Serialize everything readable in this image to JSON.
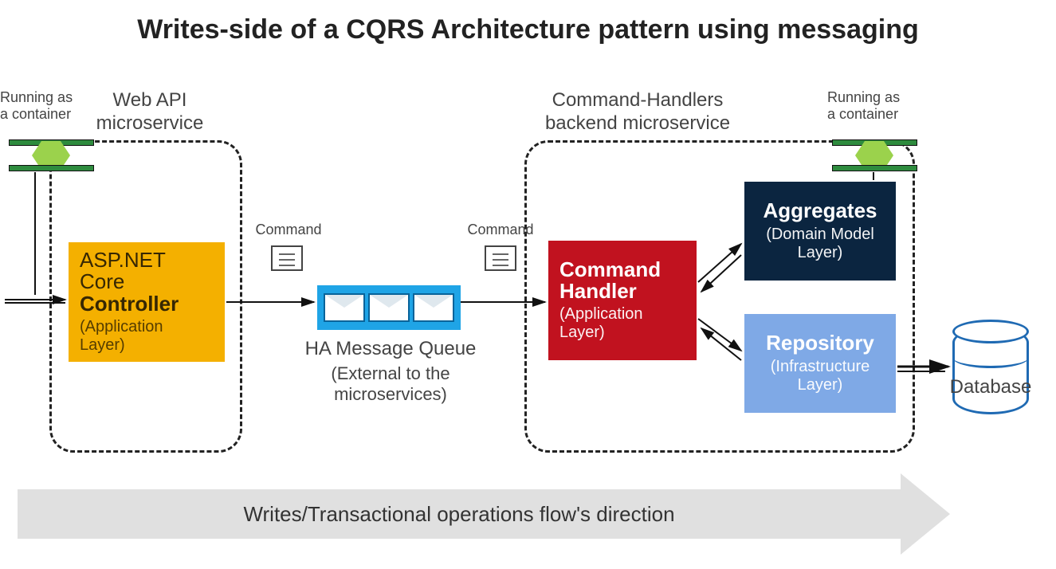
{
  "title": "Writes-side of a CQRS Architecture pattern using messaging",
  "labels": {
    "running_left": "Running as\na container",
    "running_right": "Running as\na container",
    "webapi": "Web API\nmicroservice",
    "backend": "Command-Handlers\nbackend microservice",
    "command1": "Command",
    "command2": "Command",
    "queue_title": "HA Message Queue",
    "queue_sub": "(External to the\nmicroservices)",
    "db": "Database"
  },
  "boxes": {
    "controller_t1": "ASP.NET Core",
    "controller_t2": "Controller",
    "controller_sub": "(Application\nLayer)",
    "handler_t1": "Command\nHandler",
    "handler_sub": "(Application\nLayer)",
    "aggregates_t1": "Aggregates",
    "aggregates_sub": "(Domain Model\nLayer)",
    "repo_t1": "Repository",
    "repo_sub": "(Infrastructure\nLayer)"
  },
  "flow": "Writes/Transactional operations flow's direction"
}
